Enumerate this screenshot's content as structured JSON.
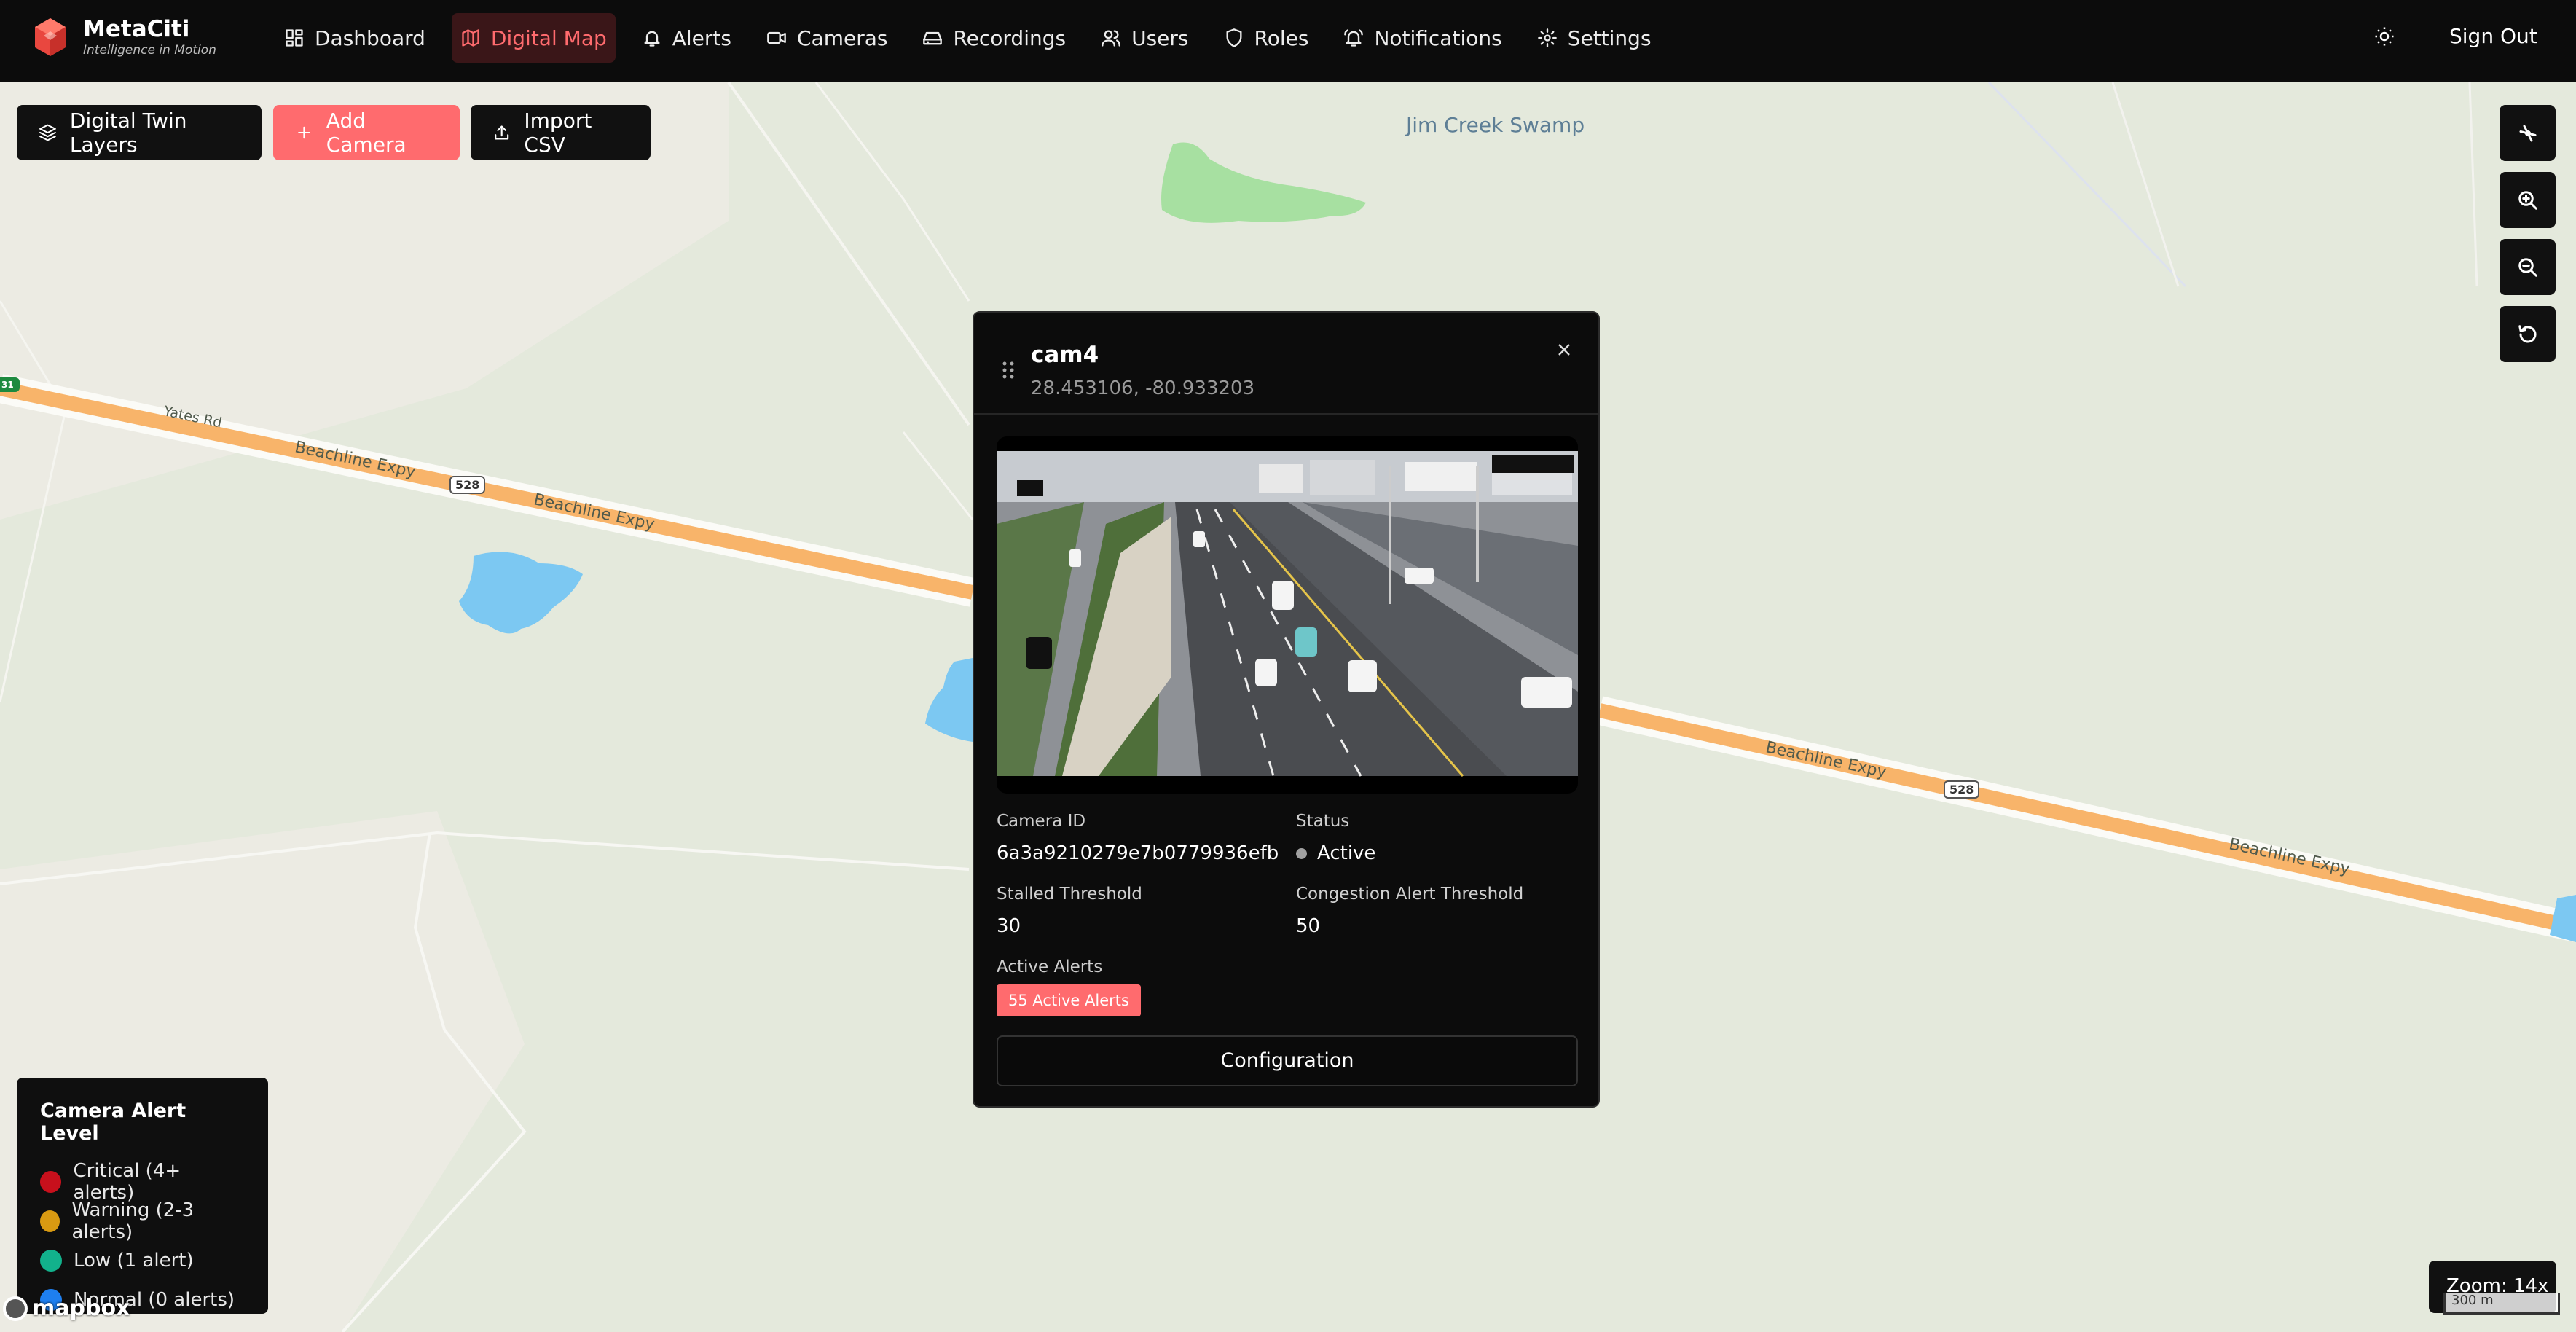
{
  "app": {
    "name": "MetaCiti",
    "tagline": "Intelligence in Motion"
  },
  "nav": {
    "items": [
      {
        "label": "Dashboard",
        "icon": "dashboard-icon",
        "active": false
      },
      {
        "label": "Digital Map",
        "icon": "map-icon",
        "active": true
      },
      {
        "label": "Alerts",
        "icon": "bell-icon",
        "active": false
      },
      {
        "label": "Cameras",
        "icon": "video-camera-icon",
        "active": false
      },
      {
        "label": "Recordings",
        "icon": "hard-drive-icon",
        "active": false
      },
      {
        "label": "Users",
        "icon": "users-icon",
        "active": false
      },
      {
        "label": "Roles",
        "icon": "shield-icon",
        "active": false
      },
      {
        "label": "Notifications",
        "icon": "bell-ring-icon",
        "active": false
      },
      {
        "label": "Settings",
        "icon": "gear-icon",
        "active": false
      }
    ],
    "theme_icon": "sun-icon",
    "sign_out": "Sign Out"
  },
  "toolbar": {
    "layers": "Digital Twin Layers",
    "add_camera": "Add Camera",
    "import_csv": "Import CSV"
  },
  "map": {
    "labels": {
      "swamp": "Jim Creek Swamp",
      "yates_rd": "Yates Rd",
      "beachline_1": "Beachline Expy",
      "beachline_2": "Beachline Expy",
      "beachline_3": "Beachline Expy",
      "beachline_4": "Beachline Expy",
      "shield_1": "528",
      "shield_2": "528",
      "edge_shield": "31"
    },
    "controls": [
      "compass-icon",
      "zoom-in-icon",
      "zoom-out-icon",
      "reset-icon"
    ],
    "zoom_text": "Zoom: 14x",
    "scale_text": "300 m",
    "attribution": "mapbox",
    "colors": {
      "land": "#e4e9dc",
      "highway": "#f8b46a",
      "water": "#7cc8f2",
      "park": "#a7e0a1"
    }
  },
  "legend": {
    "title": "Camera Alert Level",
    "items": [
      {
        "label": "Critical (4+ alerts)",
        "color": "#c8101c"
      },
      {
        "label": "Warning (2-3 alerts)",
        "color": "#d99a12"
      },
      {
        "label": "Low (1 alert)",
        "color": "#12b28c"
      },
      {
        "label": "Normal (0 alerts)",
        "color": "#1e7ff0"
      }
    ]
  },
  "popup": {
    "title": "cam4",
    "coords": "28.453106, -80.933203",
    "camera_id_label": "Camera ID",
    "camera_id": "6a3a9210279e7b0779936efb",
    "status_label": "Status",
    "status": "Active",
    "stalled_label": "Stalled Threshold",
    "stalled": "30",
    "congestion_label": "Congestion Alert Threshold",
    "congestion": "50",
    "alerts_label": "Active Alerts",
    "alerts_badge": "55 Active Alerts",
    "config_button": "Configuration"
  }
}
